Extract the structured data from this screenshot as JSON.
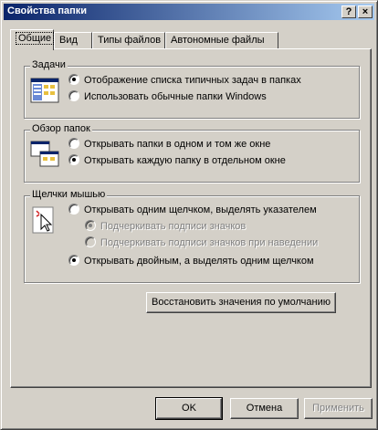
{
  "window": {
    "title": "Свойства папки",
    "help_btn": "?",
    "close_btn": "×"
  },
  "tabs": [
    {
      "label": "Общие"
    },
    {
      "label": "Вид"
    },
    {
      "label": "Типы файлов"
    },
    {
      "label": "Автономные файлы"
    }
  ],
  "tasks": {
    "legend": "Задачи",
    "option1": "Отображение списка типичных задач в папках",
    "option2": "Использовать обычные папки Windows"
  },
  "browse": {
    "legend": "Обзор папок",
    "option1": "Открывать папки в одном и том же окне",
    "option2": "Открывать каждую папку в отдельном окне"
  },
  "clicks": {
    "legend": "Щелчки мышью",
    "option1": "Открывать одним щелчком, выделять указателем",
    "sub1": "Подчеркивать подписи значков",
    "sub2": "Подчеркивать подписи значков при наведении",
    "option2": "Открывать двойным, а выделять одним щелчком"
  },
  "restore_label": "Восстановить значения по умолчанию",
  "footer": {
    "ok": "OK",
    "cancel": "Отмена",
    "apply": "Применить"
  }
}
